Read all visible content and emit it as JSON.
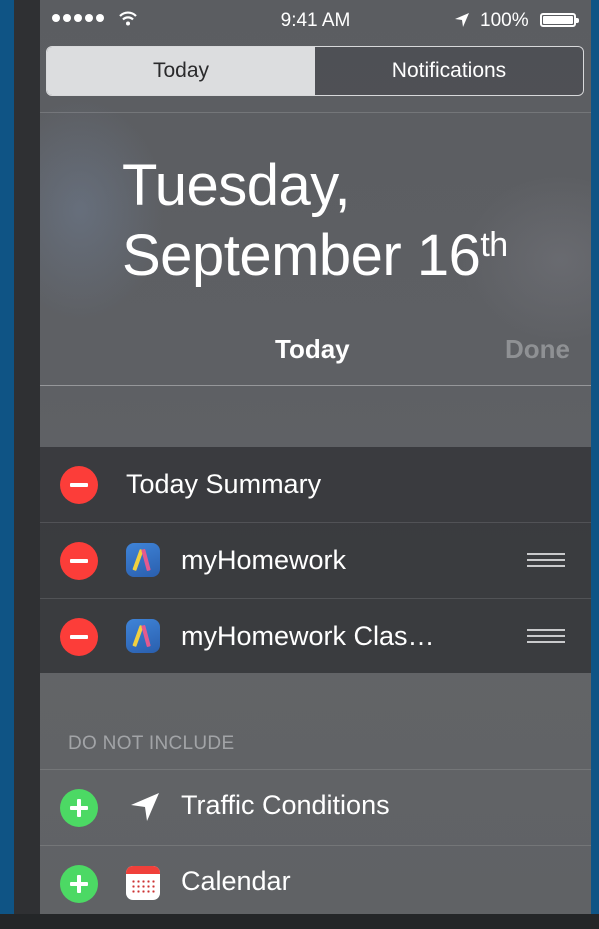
{
  "status_bar": {
    "time": "9:41 AM",
    "battery": "100%",
    "icons": [
      "signal-dots-icon",
      "wifi-icon",
      "location-arrow-icon",
      "battery-icon"
    ]
  },
  "segmented": {
    "today": "Today",
    "notifications": "Notifications",
    "selected": "Today"
  },
  "date": {
    "line1": "Tuesday,",
    "line2": "September 16",
    "suffix": "th"
  },
  "header": {
    "title": "Today",
    "done": "Done"
  },
  "included": [
    {
      "label": "Today Summary"
    },
    {
      "label": "myHomework",
      "icon": "myhomework-app-icon"
    },
    {
      "label": "myHomework Clas…",
      "icon": "myhomework-app-icon"
    }
  ],
  "exclude_header": "DO NOT INCLUDE",
  "excluded": [
    {
      "label": "Traffic Conditions",
      "icon": "location-arrow-icon"
    },
    {
      "label": "Calendar",
      "icon": "calendar-app-icon"
    }
  ],
  "colors": {
    "remove": "#fc3d39",
    "add": "#4cd964",
    "frame": "#0f5485"
  }
}
